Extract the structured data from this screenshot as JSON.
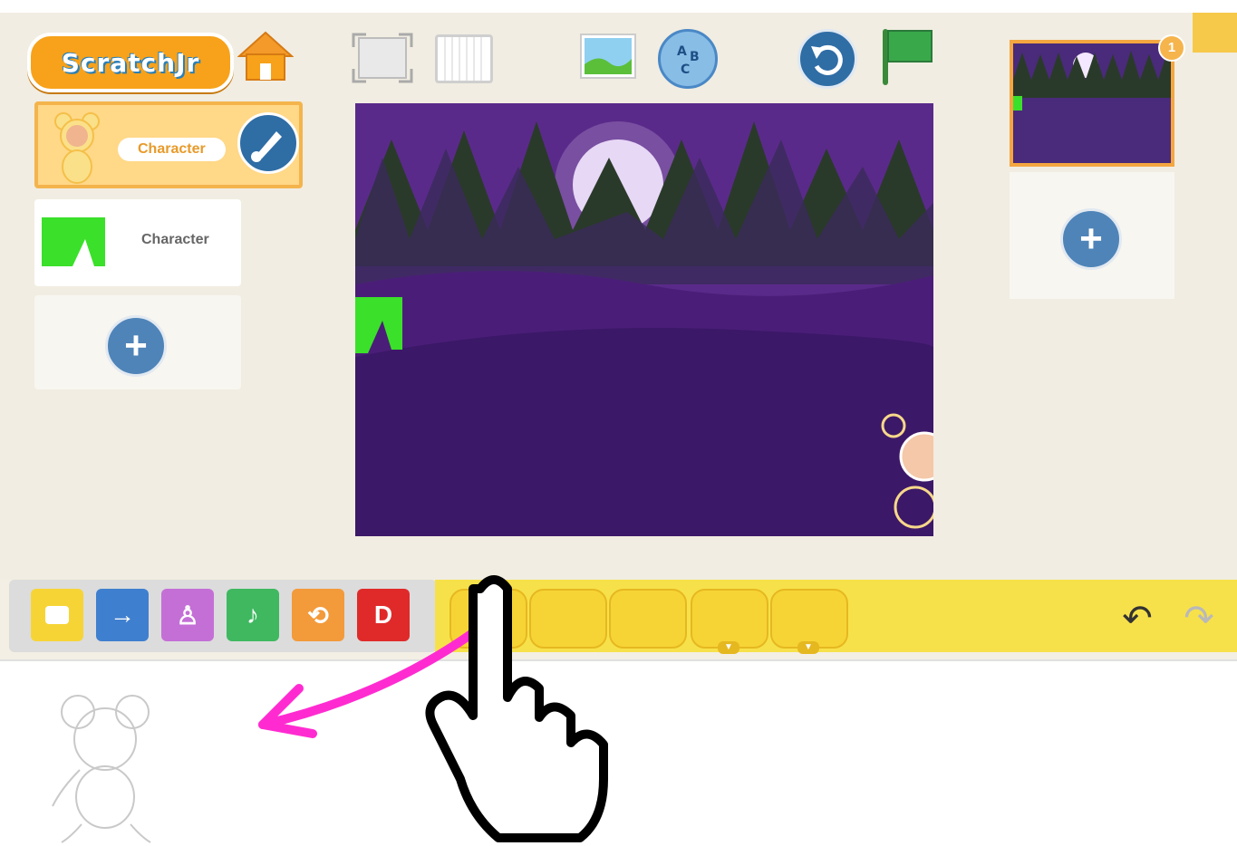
{
  "app": {
    "logo_text": "ScratchJr"
  },
  "toolbar": {
    "home_icon": "home-icon",
    "fullscreen_icon": "fullscreen-icon",
    "grid_icon": "grid-icon",
    "background_icon": "background-icon",
    "text_icon": "abc-text-icon",
    "reset_icon": "reset-icon",
    "flag_icon": "green-flag-icon"
  },
  "sprites": [
    {
      "label": "Character",
      "selected": true
    },
    {
      "label": "Character",
      "selected": false
    }
  ],
  "pages": {
    "badge": "1"
  },
  "categories": [
    {
      "name": "triggering",
      "color": "#f7d436"
    },
    {
      "name": "motion",
      "color": "#3f7fcf"
    },
    {
      "name": "looks",
      "color": "#c46fd6"
    },
    {
      "name": "sound",
      "color": "#3fb860"
    },
    {
      "name": "control",
      "color": "#f39a3a"
    },
    {
      "name": "end",
      "color": "#e02a2a"
    }
  ],
  "palette_blocks": [
    "start-on-green-flag",
    "start-on-tap",
    "start-on-bump",
    "start-on-message",
    "send-message"
  ],
  "colors": {
    "stage": "#3a1a62",
    "palette": "#f7e14a",
    "accent": "#f4a640"
  }
}
